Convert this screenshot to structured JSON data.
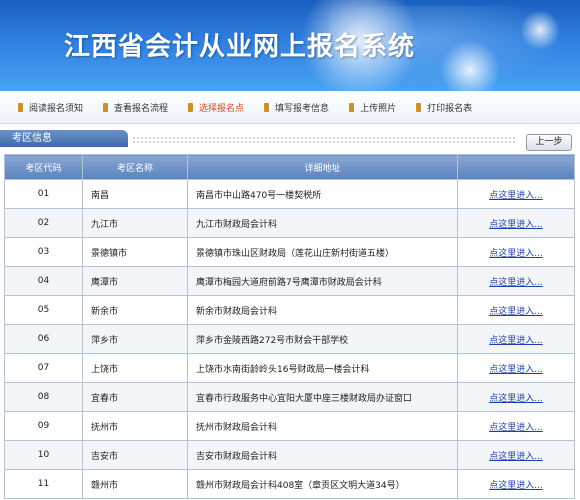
{
  "banner": {
    "title": "江西省会计从业网上报名系统"
  },
  "nav": {
    "items": [
      {
        "label": "阅读报名须知"
      },
      {
        "label": "查看报名流程"
      },
      {
        "label": "选择报名点"
      },
      {
        "label": "填写报考信息"
      },
      {
        "label": "上传照片"
      },
      {
        "label": "打印报名表"
      }
    ],
    "active_index": 2,
    "active_color": "#d24b1a"
  },
  "section": {
    "title": "考区信息",
    "back_label": "上一步"
  },
  "table": {
    "headers": {
      "code": "考区代码",
      "name": "考区名称",
      "address": "详细地址",
      "action": ""
    },
    "rows": [
      {
        "code": "01",
        "name": "南昌",
        "address": "南昌市中山路470号一楼契税所",
        "link": "点这里进入..."
      },
      {
        "code": "02",
        "name": "九江市",
        "address": "九江市财政局会计科",
        "link": "点这里进入..."
      },
      {
        "code": "03",
        "name": "景德镇市",
        "address": "景德镇市珠山区财政局（莲花山庄新村街道五楼）",
        "link": "点这里进入..."
      },
      {
        "code": "04",
        "name": "鹰潭市",
        "address": "鹰潭市梅园大道府前路7号鹰潭市财政局会计科",
        "link": "点这里进入..."
      },
      {
        "code": "05",
        "name": "新余市",
        "address": "新余市财政局会计科",
        "link": "点这里进入..."
      },
      {
        "code": "06",
        "name": "萍乡市",
        "address": "萍乡市金陵西路272号市财会干部学校",
        "link": "点这里进入..."
      },
      {
        "code": "07",
        "name": "上饶市",
        "address": "上饶市水南街龄岭头16号财政局一楼会计科",
        "link": "点这里进入..."
      },
      {
        "code": "08",
        "name": "宜春市",
        "address": "宜春市行政服务中心宜阳大厦中座三楼财政局办证窗口",
        "link": "点这里进入..."
      },
      {
        "code": "09",
        "name": "抚州市",
        "address": "抚州市财政局会计科",
        "link": "点这里进入..."
      },
      {
        "code": "10",
        "name": "吉安市",
        "address": "吉安市财政局会计科",
        "link": "点这里进入..."
      },
      {
        "code": "11",
        "name": "赣州市",
        "address": "赣州市财政局会计科408室（章贡区文明大道34号）",
        "link": "点这里进入..."
      }
    ]
  }
}
